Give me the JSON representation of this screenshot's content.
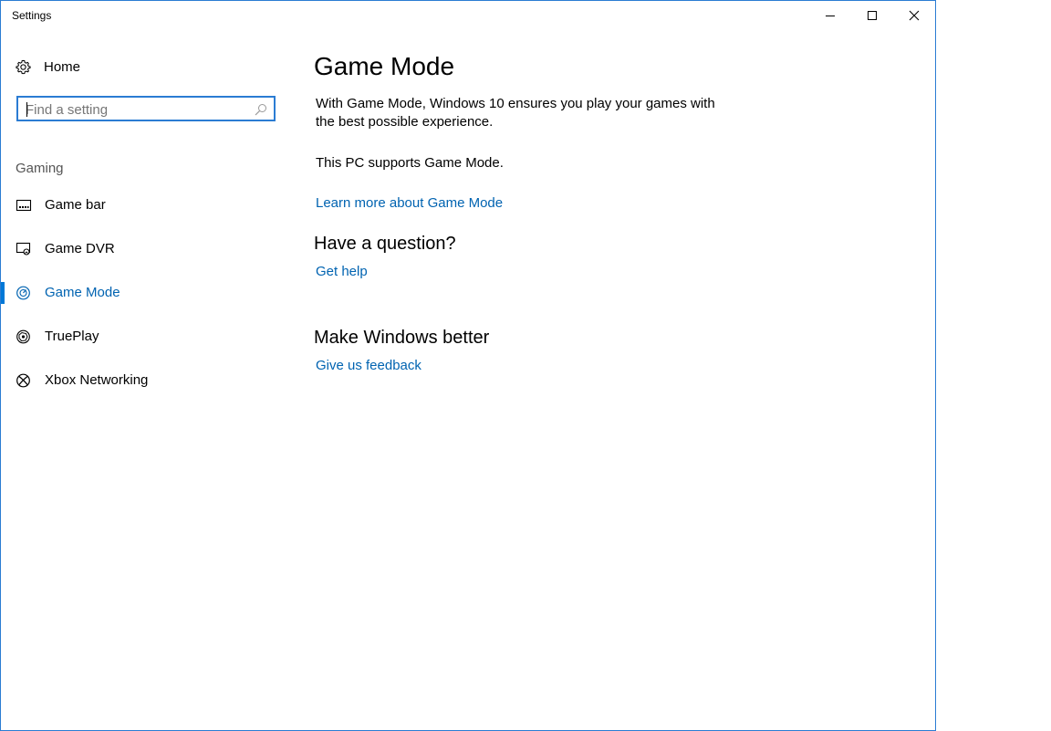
{
  "window": {
    "title": "Settings",
    "accent_color": "#0078d7",
    "link_color": "#0063b1",
    "border_color": "#2b7cd3"
  },
  "sidebar": {
    "home_label": "Home",
    "search": {
      "placeholder": "Find a setting",
      "value": ""
    },
    "section_label": "Gaming",
    "items": [
      {
        "label": "Game bar",
        "icon": "game-bar-icon",
        "active": false
      },
      {
        "label": "Game DVR",
        "icon": "game-dvr-icon",
        "active": false
      },
      {
        "label": "Game Mode",
        "icon": "game-mode-icon",
        "active": true
      },
      {
        "label": "TruePlay",
        "icon": "trueplay-icon",
        "active": false
      },
      {
        "label": "Xbox Networking",
        "icon": "xbox-icon",
        "active": false
      }
    ]
  },
  "main": {
    "title": "Game Mode",
    "description": "With Game Mode, Windows 10 ensures you play your games with the best possible experience.",
    "support_status": "This PC supports Game Mode.",
    "learn_more_link": "Learn more about Game Mode",
    "question_heading": "Have a question?",
    "get_help_link": "Get help",
    "feedback_heading": "Make Windows better",
    "feedback_link": "Give us feedback"
  }
}
